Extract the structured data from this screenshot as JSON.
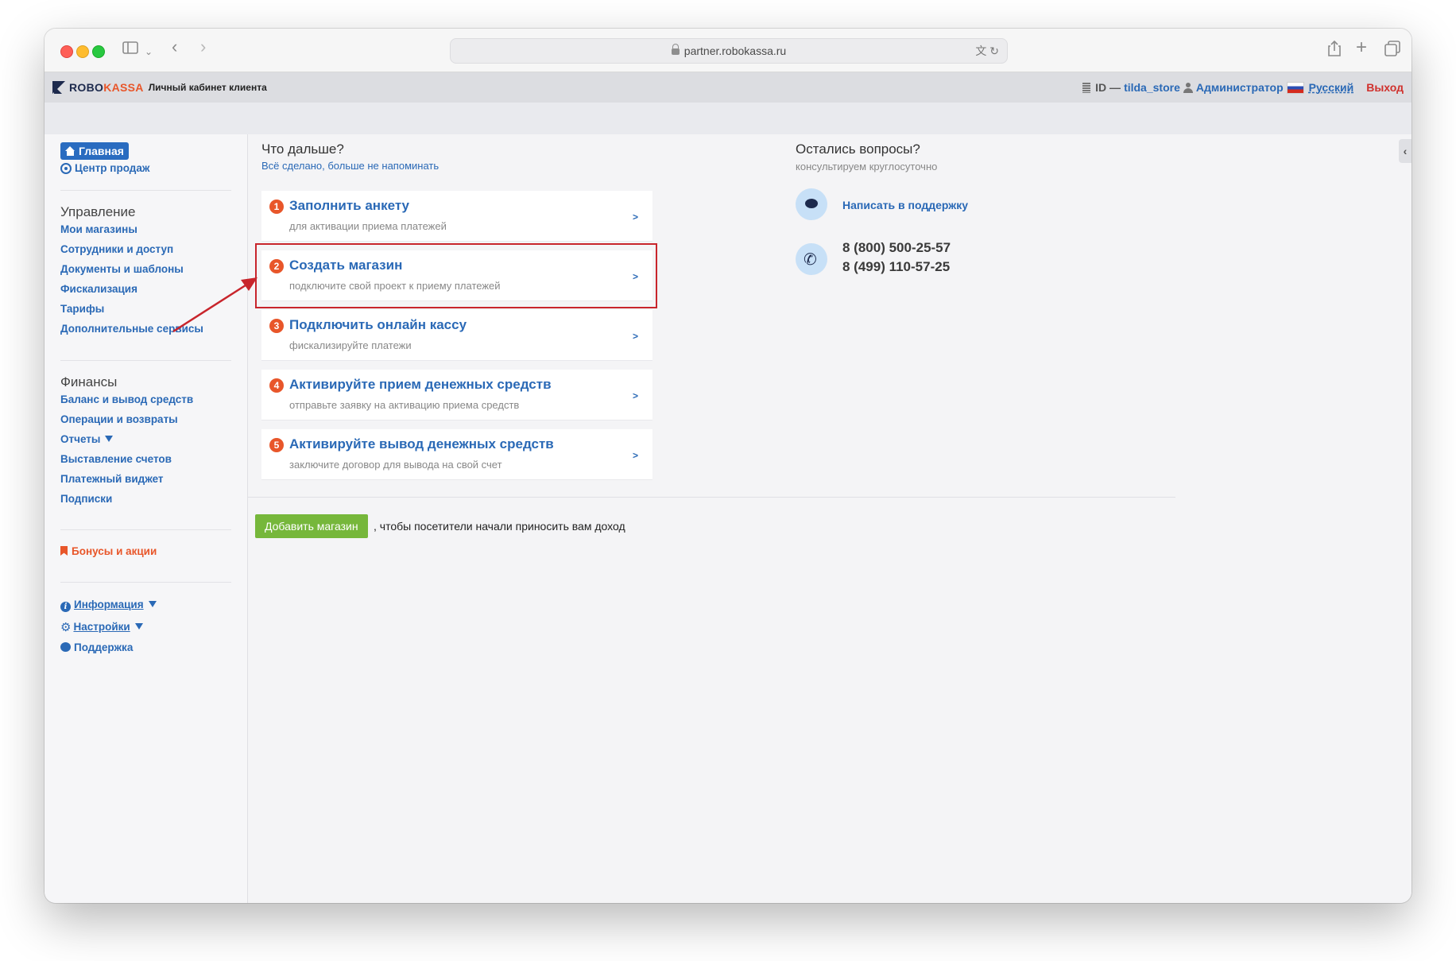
{
  "browser": {
    "url": "partner.robokassa.ru",
    "icons": [
      "sidebar-toggle-icon",
      "chevron-down-icon",
      "back-icon",
      "forward-icon",
      "translate-icon",
      "reload-icon",
      "share-icon",
      "new-tab-icon",
      "tabs-overview-icon"
    ]
  },
  "header": {
    "logo_robo": "ROBO",
    "logo_kassa": "KASSA",
    "subtitle": "Личный кабинет клиента",
    "id_label": "ID —",
    "store": "tilda_store",
    "role": "Администратор",
    "language": "Русский",
    "exit": "Выход"
  },
  "sidebar": {
    "home": "Главная",
    "sales_center": "Центр продаж",
    "management": {
      "heading": "Управление",
      "items": [
        "Мои магазины",
        "Сотрудники и доступ",
        "Документы и шаблоны",
        "Фискализация",
        "Тарифы",
        "Дополнительные сервисы"
      ]
    },
    "finance": {
      "heading": "Финансы",
      "items": [
        "Баланс и вывод средств",
        "Операции и возвраты",
        "Отчеты",
        "Выставление счетов",
        "Платежный виджет",
        "Подписки"
      ]
    },
    "bonus": "Бонусы и акции",
    "info": "Информация",
    "settings": "Настройки",
    "support": "Поддержка"
  },
  "next": {
    "title": "Что дальше?",
    "dismiss": "Всё сделано, больше не напоминать",
    "steps": [
      {
        "num": "1",
        "title": "Заполнить анкету",
        "desc": "для активации приема платежей",
        "arrow": ">"
      },
      {
        "num": "2",
        "title": "Создать магазин",
        "desc": "подключите свой проект к приему платежей",
        "arrow": ">"
      },
      {
        "num": "3",
        "title": "Подключить онлайн кассу",
        "desc": "фискализируйте платежи",
        "arrow": ">"
      },
      {
        "num": "4",
        "title": "Активируйте прием денежных средств",
        "desc": "отправьте заявку на активацию приема средств",
        "arrow": ">"
      },
      {
        "num": "5",
        "title": "Активируйте вывод денежных средств",
        "desc": "заключите договор для вывода на свой счет",
        "arrow": ">"
      }
    ]
  },
  "questions": {
    "title": "Остались вопросы?",
    "subtitle": "консультируем круглосуточно",
    "write_support": "Написать в поддержку",
    "phone1": "8 (800) 500-25-57",
    "phone2": "8 (499) 110-57-25"
  },
  "cta": {
    "button": "Добавить магазин",
    "text": ", чтобы посетители начали приносить вам доход"
  },
  "colors": {
    "accent_blue": "#2a69b6",
    "orange": "#e8562a",
    "highlight_red": "#c8252c",
    "button_green": "#76b73b"
  }
}
